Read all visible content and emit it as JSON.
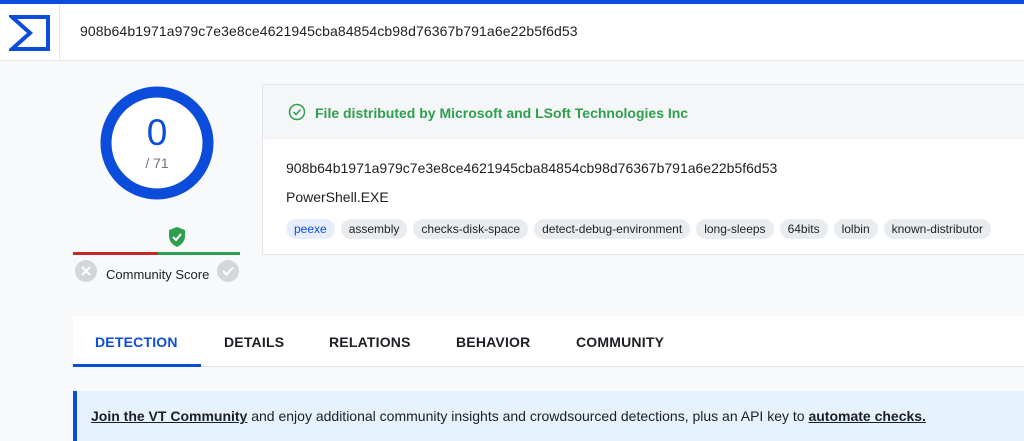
{
  "search": {
    "value": "908b64b1971a979c7e3e8ce4621945cba84854cb98d76367b791a6e22b5f6d53"
  },
  "score": {
    "detections": "0",
    "total": "/ 71"
  },
  "community": {
    "label": "Community Score"
  },
  "file": {
    "distributor": "File distributed by Microsoft and LSoft Technologies Inc",
    "hash": "908b64b1971a979c7e3e8ce4621945cba84854cb98d76367b791a6e22b5f6d53",
    "name": "PowerShell.EXE",
    "tags": [
      "peexe",
      "assembly",
      "checks-disk-space",
      "detect-debug-environment",
      "long-sleeps",
      "64bits",
      "lolbin",
      "known-distributor"
    ]
  },
  "tabs": [
    "DETECTION",
    "DETAILS",
    "RELATIONS",
    "BEHAVIOR",
    "COMMUNITY"
  ],
  "banner": {
    "link1": "Join the VT Community",
    "middle": " and enjoy additional community insights and crowdsourced detections, plus an API key to ",
    "link2": "automate checks."
  },
  "colors": {
    "accent": "#0b4dda",
    "success": "#2e9f4d",
    "danger": "#c62828"
  },
  "icons": {
    "logo": "virustotal-logo-icon",
    "distributor": "check-circle-icon",
    "shield": "shield-check-icon",
    "downvote": "close-circle-icon",
    "upvote": "check-circle-icon"
  }
}
